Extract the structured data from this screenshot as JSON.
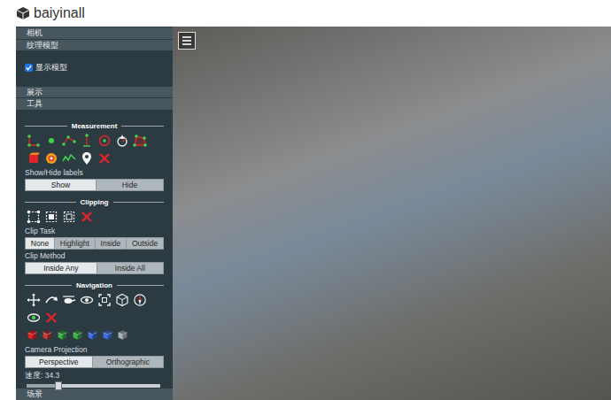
{
  "header": {
    "title": "baiyinall"
  },
  "sidebar": {
    "panels_top": [
      {
        "label": "相机"
      },
      {
        "label": "纹理模型"
      }
    ],
    "show_model": {
      "label": "显示模型",
      "checked": true
    },
    "panels_mid": [
      {
        "label": "展示"
      },
      {
        "label": "工具"
      }
    ],
    "measurement": {
      "title": "Measurement",
      "labels_title": "Show/Hide labels",
      "labels_options": [
        {
          "label": "Show",
          "selected": true
        },
        {
          "label": "Hide",
          "selected": false
        }
      ]
    },
    "clipping": {
      "title": "Clipping",
      "task_title": "Clip Task",
      "task_options": [
        {
          "label": "None",
          "selected": true
        },
        {
          "label": "Highlight",
          "selected": false
        },
        {
          "label": "Inside",
          "selected": false
        },
        {
          "label": "Outside",
          "selected": false
        }
      ],
      "method_title": "Clip Method",
      "method_options": [
        {
          "label": "Inside Any",
          "selected": true
        },
        {
          "label": "Inside All",
          "selected": false
        }
      ]
    },
    "navigation": {
      "title": "Navigation",
      "projection_title": "Camera Projection",
      "projection_options": [
        {
          "label": "Perspective",
          "selected": true
        },
        {
          "label": "Orthographic",
          "selected": false
        }
      ],
      "speed": {
        "label": "速度: 34.3",
        "level": 0.24
      }
    },
    "panels_bottom": [
      {
        "label": "场景"
      }
    ]
  }
}
